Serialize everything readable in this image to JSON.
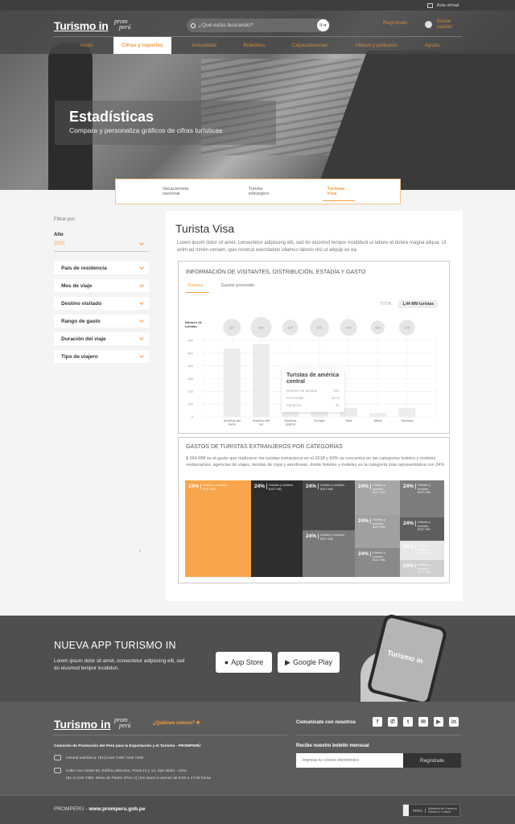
{
  "topbar": {
    "aula_virtual": "Aula virtual"
  },
  "header": {
    "logo": "Turismo in",
    "partner_logo": [
      "prom",
      "perú"
    ],
    "search": {
      "placeholder": "¿Qué estás buscando?",
      "go_label": "Ir"
    },
    "register": "Regístrate",
    "login": [
      "Iniciar",
      "sesión"
    ]
  },
  "nav": {
    "items": [
      "Inicio",
      "Cifras y reportes",
      "Actualidad",
      "Boletines",
      "Capacitaciones",
      "Videos y podcasts",
      "Ayuda"
    ],
    "active": "Cifras y reportes"
  },
  "hero": {
    "title": "Estadísticas",
    "subtitle": "Compara y personaliza gráficos  de cifras turísticas"
  },
  "section_tabs": {
    "items": [
      "Vacacionista nacional",
      "Turista extranjero",
      "Turistas Visa"
    ],
    "active": "Turistas Visa"
  },
  "filters": {
    "label": "Filtrar por:",
    "year_label": "Año",
    "year_value": "2020",
    "items": [
      "País de residencia",
      "Mes de viaje",
      "Destino visitado",
      "Rango de gasto",
      "Duración del viaje",
      "Tipo de viajero"
    ]
  },
  "main": {
    "title": "Turista Visa",
    "description": "Lorem ipsum dolor sit amet, consectetur adipiscing elit, sed do eiusmod tempor incididunt ut labore et dolore magna aliqua. Ut enim ad minim veniam, quis nostrud exercitation ullamco laboris nisi ut aliquip ex ea.",
    "card1": {
      "title": "INFORMACIÓN DE VISITANTES, DISTRIBUCIÓN, ESTADÍA Y GASTO",
      "tabs": [
        "Turistas",
        "Gastos promedio"
      ],
      "active_tab": "Turistas",
      "total_label": "TOTAL",
      "total_value": "1,44 MM turistas",
      "tooltip": {
        "title": "Turistas de américa central",
        "rows": [
          {
            "label": "Número de turistas",
            "value": "541"
          },
          {
            "label": "Porcentaje",
            "value": "43 %"
          },
          {
            "label": "Variación",
            "value": "31"
          }
        ]
      }
    },
    "card2": {
      "title": "GASTOS DE TURISTAS EXTRANJEROS POR CATEGORÍAS",
      "description": "$ 664 MM es el gasto que realizaron los turistas extranjeros en el 2018 y 60% se concentra en las categorías hoteles y moteles, restaurantes, agencias de viajes, tiendas de ropa y aerolíneas, donte hoteles y moteles es la categoría más representativa con 24%",
      "treemap": [
        {
          "pct": "24%",
          "label": "Hoteles y moteles",
          "amount": "$157 MM",
          "color": "#f9a54b"
        },
        {
          "pct": "24%",
          "label": "Hoteles y moteles",
          "amount": "$157 MM",
          "color": "#2e2e2e"
        },
        {
          "pct": "24%",
          "label": "Hoteles y moteles",
          "amount": "$157 MM",
          "color": "#4a4a4a"
        },
        {
          "pct": "24%",
          "label": "Hoteles y moteles",
          "amount": "$157 MM",
          "color": "#7a7a7a"
        },
        {
          "pct": "24%",
          "label": "Hoteles y moteles",
          "amount": "$157 MM",
          "color": "#a6a6a6"
        },
        {
          "pct": "24%",
          "label": "Hoteles y moteles",
          "amount": "$157 MM",
          "color": "#a0a0a0"
        },
        {
          "pct": "24%",
          "label": "Hoteles y moteles",
          "amount": "$157 MM",
          "color": "#8a8a8a"
        },
        {
          "pct": "24%",
          "label": "Hoteles y moteles",
          "amount": "$157 MM",
          "color": "#7d7d7d"
        },
        {
          "pct": "24%",
          "label": "Hoteles y moteles",
          "amount": "$157 MM",
          "color": "#5e5e5e"
        },
        {
          "pct": "24%",
          "label": "Hoteles y moteles",
          "amount": "$157 MM",
          "color": "#e8e8e8"
        },
        {
          "pct": "24%",
          "label": "Hoteles y moteles",
          "amount": "$157 MM",
          "color": "#cfcfcf"
        }
      ]
    }
  },
  "chart_data": {
    "type": "bar",
    "title": "INFORMACIÓN DE VISITANTES, DISTRIBUCIÓN, ESTADÍA Y GASTO",
    "ylabel": "Número de turistas",
    "xlabel": "",
    "categories": [
      "América del norte",
      "América del sur",
      "América central",
      "Europa",
      "Asia",
      "África",
      "Oceanía"
    ],
    "values": [
      535,
      570,
      60,
      110,
      70,
      30,
      70
    ],
    "bubble_labels": [
      "11%",
      "11%",
      "11%",
      "11%",
      "11%",
      "11%",
      "11%"
    ],
    "bubble_sizes": [
      0.75,
      1.0,
      0.6,
      0.85,
      0.7,
      0.45,
      0.6
    ],
    "yticks": [
      0,
      100,
      200,
      300,
      400,
      500,
      600
    ],
    "ylim": [
      0,
      600
    ],
    "grid": true,
    "bar_color": "#ececec"
  },
  "app_promo": {
    "title": "NUEVA APP TURISMO IN",
    "text": "Lorem ipsum dolor sit amet, consectetur adipiscing elit, sed do eiusmod tempor incididun.",
    "app_store": "App Store",
    "google_play": "Google Play",
    "phone_logo": "Turismo in"
  },
  "footer": {
    "logo": "Turismo in",
    "who": "¿Quiénes somos?",
    "org": "Comisión de Promoción del Perú para la Exportación y el Turismo - PROMPERÚ",
    "phone": "Central telefónica: (511) 616 7300 / 616 7400",
    "address1": "Calle Uno Oeste 50, Edificio Mincetur, Pisos 13 y 14, San Isidro - Lima",
    "address2": "(51-1) 616 7300. Mesa de Partes (Piso 1) | De lunes a viernes de 9:00 a 17:00 horas",
    "contact": "Comunícate con nosotros",
    "social": [
      "facebook",
      "whatsapp",
      "twitter",
      "email",
      "youtube",
      "linkedin"
    ],
    "newsletter_label": "Recibe nuestro boletín mensual",
    "newsletter_placeholder": "Ingresa tu correo electrónico",
    "newsletter_button": "Regístrate",
    "bottom_prefix": "PROMPERÚ - ",
    "bottom_url": "www.promperu.gob.pe",
    "ministry": [
      "PERÚ",
      "Ministerio de Comercio Exterior y Turismo"
    ]
  }
}
